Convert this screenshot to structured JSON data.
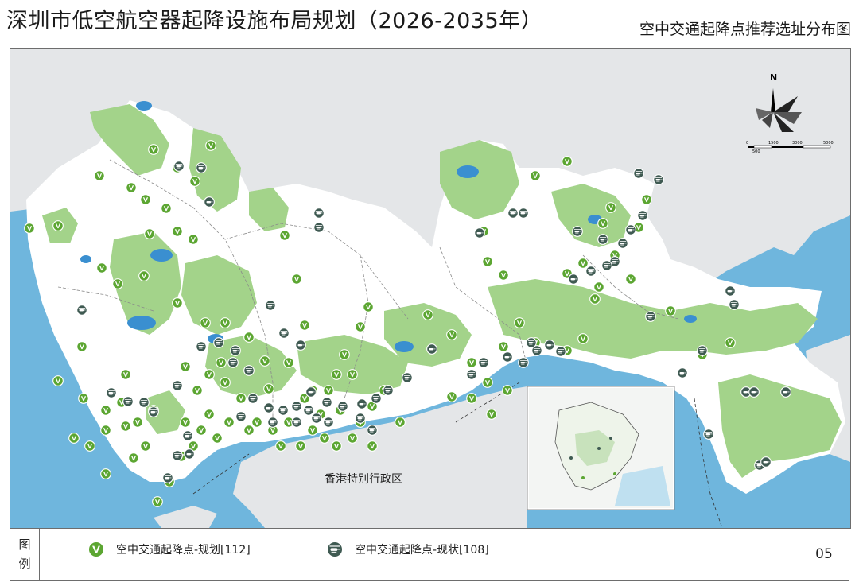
{
  "title": "深圳市低空航空器起降设施布局规划（2026-2035年）",
  "subtitle": "空中交通起降点推荐选址分布图",
  "map": {
    "region_label": "香港特别行政区",
    "compass_letter": "N",
    "scale_labels": [
      "0",
      "500",
      "1500",
      "3000",
      "5000"
    ],
    "colors": {
      "sea": "#6fb6dd",
      "land": "#e4e6e8",
      "shenzhen_land": "#ffffff",
      "green_space": "#a3d38a",
      "reservoir": "#3a8fd0",
      "planned_marker": "#5ca632",
      "existing_marker": "#3f5a52"
    }
  },
  "legend": {
    "head": [
      "图",
      "例"
    ],
    "items": [
      {
        "icon": "planned-takeoff-point-icon",
        "label": "空中交通起降点-规划[112]"
      },
      {
        "icon": "existing-helipad-icon",
        "label": "空中交通起降点-现状[108]"
      }
    ],
    "page_number": "05"
  }
}
